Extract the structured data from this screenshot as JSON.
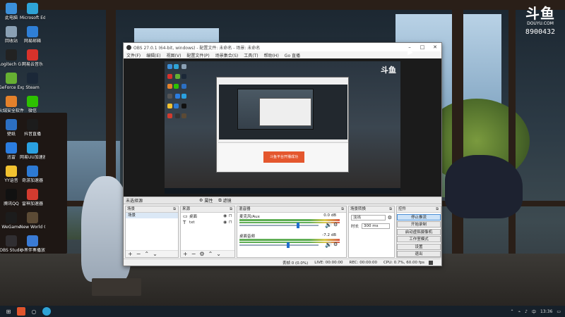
{
  "desktop": {
    "icons": [
      {
        "label": "此电脑",
        "color": "#3b8fd9"
      },
      {
        "label": "Microsoft Edge",
        "color": "#2ea3d6"
      },
      {
        "label": "回收站",
        "color": "#8aa0b4"
      },
      {
        "label": "网易邮箱",
        "color": "#2f7fd6"
      },
      {
        "label": "Logitech G HUB",
        "color": "#222222"
      },
      {
        "label": "网易云音乐",
        "color": "#d8322b"
      },
      {
        "label": "GeForce Experience",
        "color": "#66b032"
      },
      {
        "label": "Steam",
        "color": "#1b2838"
      },
      {
        "label": "火绒安全软件",
        "color": "#e3812b"
      },
      {
        "label": "微信",
        "color": "#2dc100"
      },
      {
        "label": "壁纸",
        "color": "#2c6fc2"
      },
      {
        "label": "抖音直播",
        "color": "#1c1c1c"
      },
      {
        "label": "迅雷",
        "color": "#2b7de0"
      },
      {
        "label": "网易UU加速器",
        "color": "#2aa0e0"
      },
      {
        "label": "YY语音",
        "color": "#f2c230"
      },
      {
        "label": "奇游加速器",
        "color": "#2d7ad4"
      },
      {
        "label": "腾讯QQ",
        "color": "#111111"
      },
      {
        "label": "雷神加速器",
        "color": "#d23b2f"
      },
      {
        "label": "WeGame",
        "color": "#1c1c1c"
      },
      {
        "label": "New World Open Beta",
        "color": "#5b4a35"
      },
      {
        "label": "OBS Studio",
        "color": "#302e31"
      },
      {
        "label": "小黑伴奏播放器",
        "color": "#3a7bd5"
      }
    ]
  },
  "watermark": {
    "logo": "斗鱼",
    "site": "DOUYU.COM",
    "room": "8900432"
  },
  "obs": {
    "title": "OBS 27.0.1 (64-bit, windows) - 配置文件: 未命名 - 场景: 未命名",
    "menu": [
      "文件(F)",
      "编辑(E)",
      "视图(V)",
      "配置文件(P)",
      "场景集合(S)",
      "工具(T)",
      "帮助(H)",
      "Go 直播"
    ],
    "preview_banner": "斗鱼平台开播成功",
    "preview_logo": "斗鱼",
    "status_strip": {
      "source_name": "未选择源",
      "properties": "属性",
      "filters": "滤镜"
    },
    "scenes": {
      "title": "场景",
      "items": [
        "场景"
      ]
    },
    "sources": {
      "title": "来源",
      "items": [
        {
          "icon": "display",
          "label": "桌面"
        },
        {
          "icon": "text",
          "label": "txt"
        }
      ]
    },
    "mixer": {
      "title": "混音器",
      "tracks": [
        {
          "name": "麦克风/Aux",
          "db": "0.0 dB",
          "level": 0.72
        },
        {
          "name": "桌面音频",
          "db": "-7.2 dB",
          "level": 0.6
        }
      ]
    },
    "transitions": {
      "title": "场景转换",
      "type": "淡出",
      "duration_label": "时长",
      "duration": "300 ms"
    },
    "controls": {
      "title": "控件",
      "buttons": [
        "停止推流",
        "开始录制",
        "启动虚拟摄像机",
        "工作室模式",
        "设置",
        "退出"
      ]
    },
    "statusbar": {
      "dropped": "丢帧 0 (0.0%)",
      "live": "LIVE: 00:00:00",
      "rec": "REC: 00:00:00",
      "cpu": "CPU: 0.7%, 60.00 fps"
    }
  },
  "taskbar": {
    "time": "13:36",
    "date": "2021/8/9",
    "lang": "中"
  }
}
